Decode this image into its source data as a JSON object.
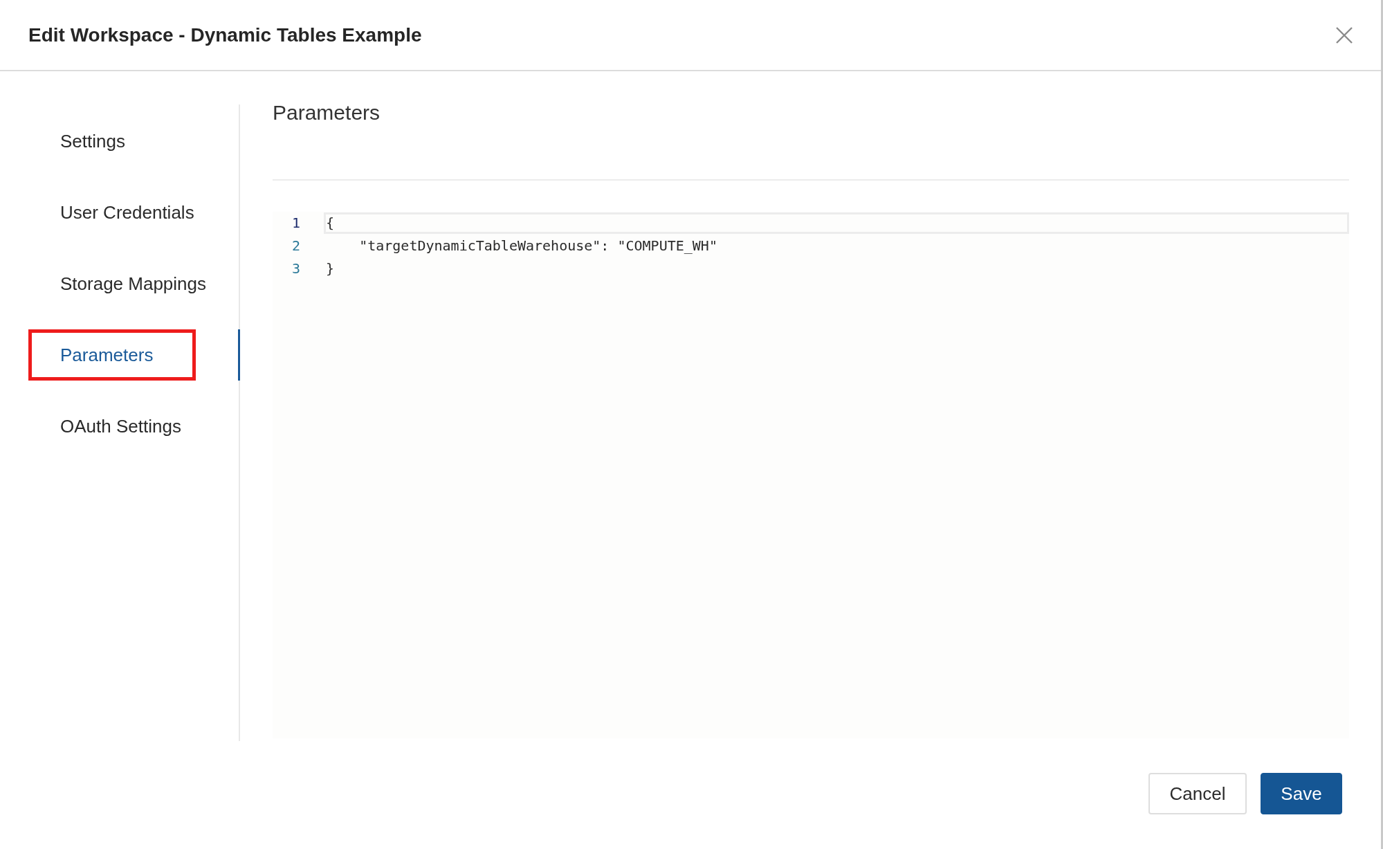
{
  "dialog": {
    "title": "Edit Workspace - Dynamic Tables Example"
  },
  "sidebar": {
    "items": [
      {
        "label": "Settings",
        "selected": false,
        "highlighted": false
      },
      {
        "label": "User Credentials",
        "selected": false,
        "highlighted": false
      },
      {
        "label": "Storage Mappings",
        "selected": false,
        "highlighted": false
      },
      {
        "label": "Parameters",
        "selected": true,
        "highlighted": true
      },
      {
        "label": "OAuth Settings",
        "selected": false,
        "highlighted": false
      }
    ]
  },
  "content": {
    "heading": "Parameters",
    "editor": {
      "lines": [
        {
          "number": "1",
          "text": "{",
          "active": true
        },
        {
          "number": "2",
          "text": "    \"targetDynamicTableWarehouse\": \"COMPUTE_WH\"",
          "active": false
        },
        {
          "number": "3",
          "text": "}",
          "active": false
        }
      ]
    }
  },
  "buttons": [
    {
      "label": "Cancel",
      "kind": "secondary"
    },
    {
      "label": "Save",
      "kind": "primary"
    }
  ]
}
